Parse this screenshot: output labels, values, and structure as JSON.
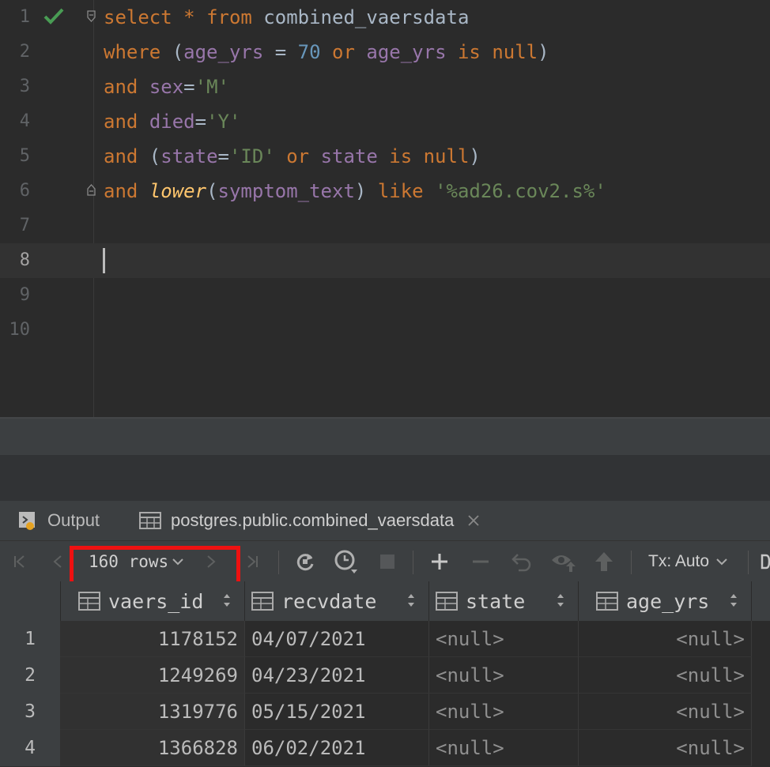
{
  "editor": {
    "lines": [
      {
        "n": "1"
      },
      {
        "n": "2"
      },
      {
        "n": "3"
      },
      {
        "n": "4"
      },
      {
        "n": "5"
      },
      {
        "n": "6"
      },
      {
        "n": "7"
      },
      {
        "n": "8"
      },
      {
        "n": "9"
      },
      {
        "n": "10"
      }
    ],
    "code": {
      "l1": [
        "select",
        " * ",
        "from",
        " combined_vaersdata"
      ],
      "l2": [
        "where",
        " (",
        "age_yrs",
        " = ",
        "70",
        " or ",
        "age_yrs",
        " is null",
        ")"
      ],
      "l3": [
        "and",
        " ",
        "sex",
        "=",
        "'M'"
      ],
      "l4": [
        "and",
        " ",
        "died",
        "=",
        "'Y'"
      ],
      "l5": [
        "and",
        " (",
        "state",
        "=",
        "'ID'",
        " or ",
        "state",
        " is null",
        ")"
      ],
      "l6": [
        "and",
        " ",
        "lower",
        "(",
        "symptom_text",
        ") ",
        "like",
        " ",
        "'%ad26.cov2.s%'"
      ]
    },
    "status_icon": "checkmark-icon"
  },
  "tabs": [
    {
      "label": "Output",
      "icon": "output-icon"
    },
    {
      "label": "postgres.public.combined_vaersdata",
      "icon": "table-icon",
      "close_icon": "close-icon"
    }
  ],
  "toolbar": {
    "rows_label": "160 rows",
    "tx_label": "Tx: Auto",
    "icons": [
      "first-page-icon",
      "prev-page-icon",
      "chevron-down-icon",
      "next-page-icon",
      "last-page-icon",
      "refresh-icon",
      "history-icon",
      "stop-icon",
      "add-row-icon",
      "delete-row-icon",
      "revert-icon",
      "preview-icon",
      "submit-icon"
    ]
  },
  "grid": {
    "columns": [
      "vaers_id",
      "recvdate",
      "state",
      "age_yrs"
    ],
    "rows": [
      {
        "n": "1",
        "vaers_id": "1178152",
        "recvdate": "04/07/2021",
        "state": "<null>",
        "age_yrs": "<null>"
      },
      {
        "n": "2",
        "vaers_id": "1249269",
        "recvdate": "04/23/2021",
        "state": "<null>",
        "age_yrs": "<null>"
      },
      {
        "n": "3",
        "vaers_id": "1319776",
        "recvdate": "05/15/2021",
        "state": "<null>",
        "age_yrs": "<null>"
      },
      {
        "n": "4",
        "vaers_id": "1366828",
        "recvdate": "06/02/2021",
        "state": "<null>",
        "age_yrs": "<null>"
      }
    ]
  },
  "colors": {
    "accent": "#cc7832",
    "highlight": "#ee1111",
    "check": "#499c54"
  }
}
